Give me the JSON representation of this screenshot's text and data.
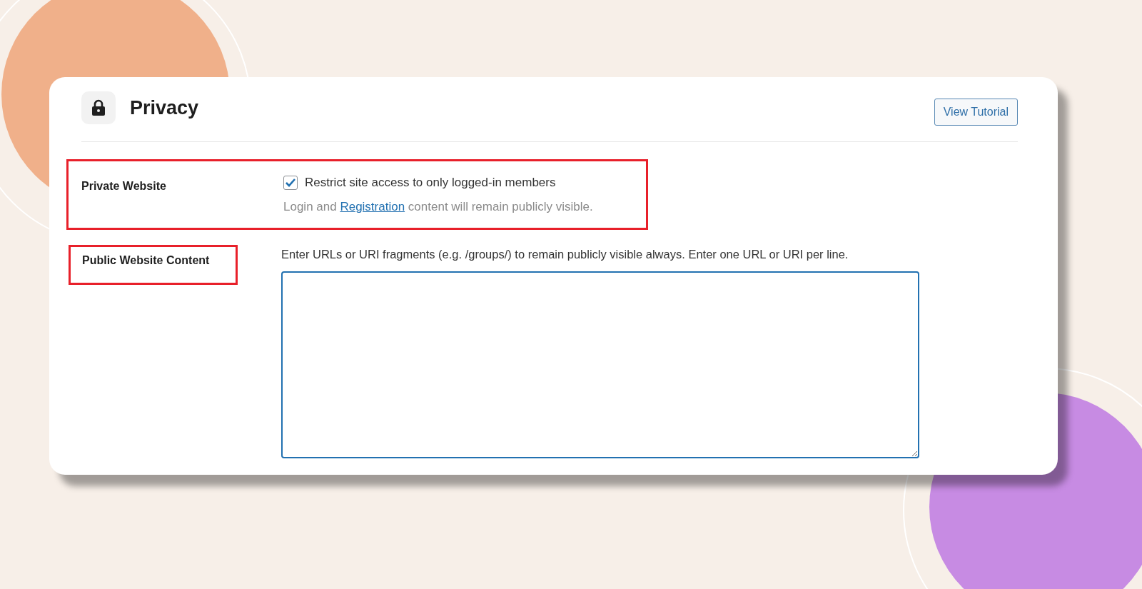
{
  "header": {
    "title": "Privacy",
    "tutorial_button": "View Tutorial"
  },
  "settings": [
    {
      "kind": "checkbox",
      "label": "Private Website",
      "highlighted": true,
      "option": "Restrict site access to only logged-in members",
      "checked": true,
      "help": {
        "before": "Login and ",
        "link": "Registration",
        "after": " content will remain publicly visible."
      }
    },
    {
      "kind": "textarea",
      "label": "Public Website Content",
      "highlighted": true,
      "description": "Enter URLs or URI fragments (e.g. /groups/) to remain publicly visible always. Enter one URL or URI per line.",
      "focused": true
    }
  ]
}
